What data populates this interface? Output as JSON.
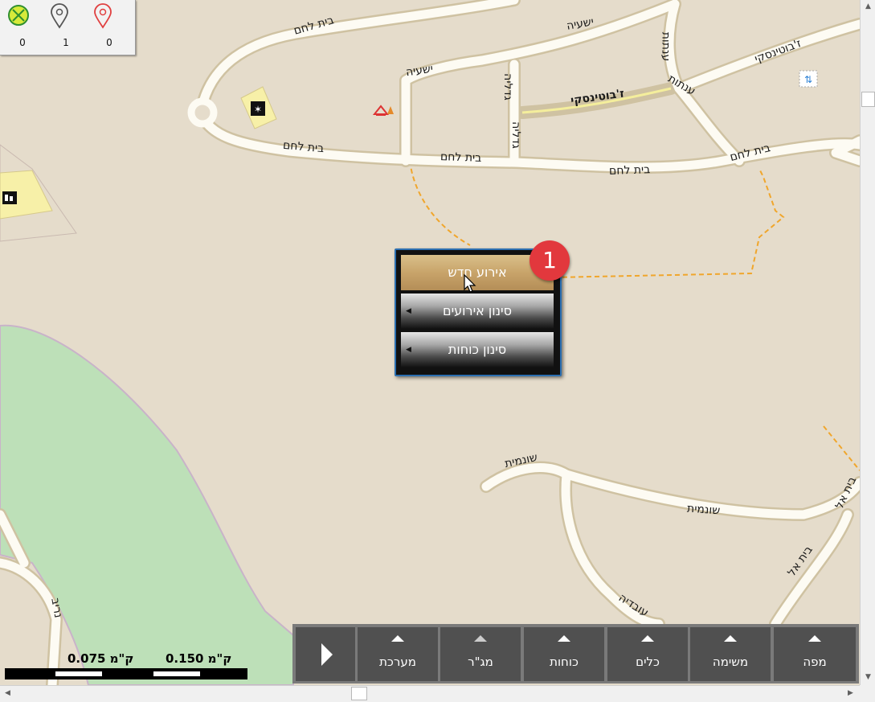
{
  "counters": [
    {
      "icon": "green-x-circle-icon",
      "value": "0"
    },
    {
      "icon": "gray-pin-icon",
      "value": "1"
    },
    {
      "icon": "red-pin-icon",
      "value": "0"
    }
  ],
  "streets": {
    "beit_lechem_1": "בית לחם",
    "beit_lechem_2": "בית לחם",
    "beit_lechem_3": "בית לחם",
    "beit_lechem_4": "בית לחם",
    "beit_lechem_5": "בית לחם",
    "yeshaya_1": "ישעיה",
    "yeshaya_2": "ישעיה",
    "gadlia_1": "גדליה",
    "gadlia_2": "גדליה",
    "anatot_1": "ענתות",
    "anatot_2": "ענתות",
    "jabotinsky_1": "ז'בוטינסקי",
    "jabotinsky_2": "ז'בוטינסקי",
    "shunamit_1": "שונמית",
    "shunamit_2": "שונמית",
    "beit_el_1": "בית אל",
    "beit_el_2": "בית אל",
    "ovadia": "עובדיה",
    "nariv": "נריב"
  },
  "context_menu": {
    "items": [
      {
        "label": "אירוע חדש",
        "has_submenu": false,
        "highlighted": true
      },
      {
        "label": "סינון אירועים",
        "has_submenu": true,
        "highlighted": false
      },
      {
        "label": "סינון כוחות",
        "has_submenu": true,
        "highlighted": false
      }
    ],
    "badge": "1"
  },
  "toolbar": {
    "play_icon": "play-icon",
    "buttons": [
      {
        "label": "מערכת"
      },
      {
        "label": "מג\"ר"
      },
      {
        "label": "כוחות"
      },
      {
        "label": "כלים"
      },
      {
        "label": "משימה"
      },
      {
        "label": "מפה"
      }
    ]
  },
  "scale": {
    "label_left": "ק\"מ 0.075",
    "label_right": "ק\"מ 0.150"
  },
  "colors": {
    "map_bg": "#e5dccb",
    "road": "#fdfbf3",
    "road_casing": "#cfc2a2",
    "park": "#bde0b8",
    "path": "#f0a62c",
    "highlight_road": "#f4ee9c",
    "menu_border": "#2b6fb1",
    "badge": "#e2383d"
  }
}
